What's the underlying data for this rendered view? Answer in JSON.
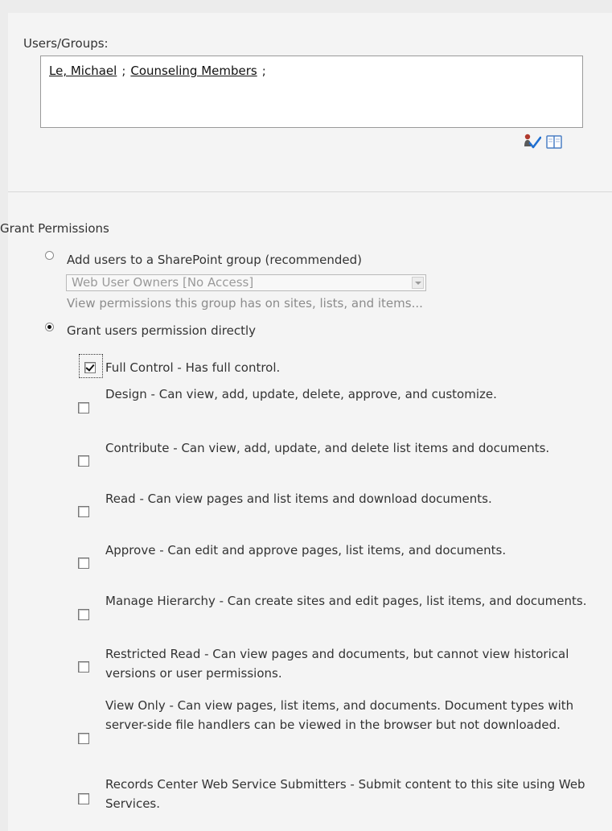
{
  "users_groups": {
    "label": "Users/Groups:",
    "entries": [
      "Le, Michael",
      "Counseling Members"
    ],
    "separator": ";"
  },
  "grant": {
    "heading": "Grant Permissions",
    "option_group": {
      "label": "Add users to a SharePoint group (recommended)",
      "selected": false,
      "select_value": "Web User Owners [No Access]",
      "hint_link": "View permissions this group has on sites, lists, and items..."
    },
    "option_direct": {
      "label": "Grant users permission directly",
      "selected": true
    },
    "permissions": [
      {
        "text": "Full Control - Has full control.",
        "checked": true
      },
      {
        "text": "Design - Can view, add, update, delete, approve, and customize.",
        "checked": false
      },
      {
        "text": "Contribute - Can view, add, update, and delete list items and documents.",
        "checked": false
      },
      {
        "text": "Read - Can view pages and list items and download documents.",
        "checked": false
      },
      {
        "text": "Approve - Can edit and approve pages, list items, and documents.",
        "checked": false
      },
      {
        "text": "Manage Hierarchy - Can create sites and edit pages, list items, and documents.",
        "checked": false
      },
      {
        "text": "Restricted Read - Can view pages and documents, but cannot view historical versions or user permissions.",
        "checked": false
      },
      {
        "text": "View Only - Can view pages, list items, and documents. Document types with server-side file handlers can be viewed in the browser but not downloaded.",
        "checked": false
      },
      {
        "text": "Records Center Web Service Submitters - Submit content to this site using Web Services.",
        "checked": false
      }
    ]
  },
  "icons": {
    "check_names": "check-names-icon",
    "address_book": "address-book-icon"
  },
  "colors": {
    "panel_bg": "#f4f4f4",
    "page_bg": "#ececec",
    "divider": "#d8d8d8",
    "text": "#333333",
    "hint_text": "#8c8c8c"
  }
}
